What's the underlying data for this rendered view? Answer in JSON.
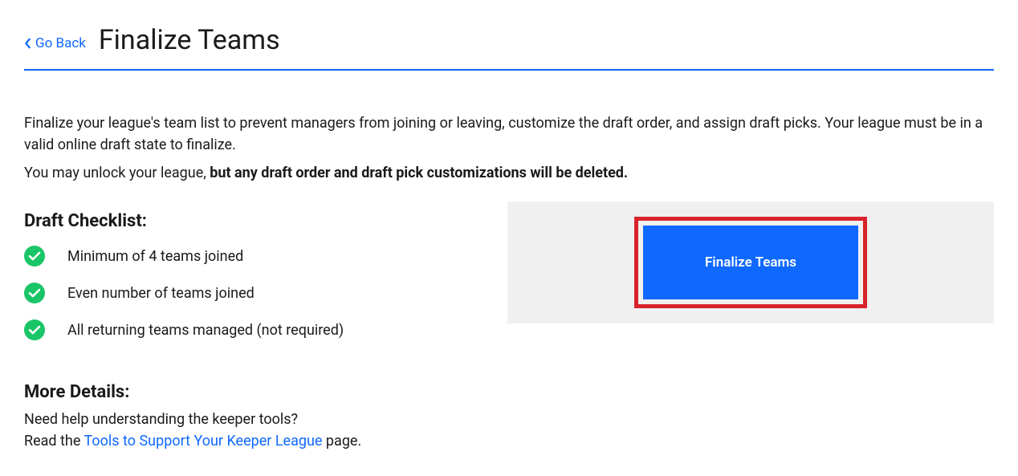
{
  "header": {
    "goBack": "Go Back",
    "title": "Finalize Teams"
  },
  "intro": "Finalize your league's team list to prevent managers from joining or leaving, customize the draft order, and assign draft picks. Your league must be in a valid online draft state to finalize.",
  "unlock": {
    "prefix": "You may unlock your league, ",
    "bold": "but any draft order and draft pick customizations will be deleted."
  },
  "checklistHeading": "Draft Checklist:",
  "checklist": [
    "Minimum of 4 teams joined",
    "Even number of teams joined",
    "All returning teams managed (not required)"
  ],
  "moreDetailsHeading": "More Details:",
  "help": {
    "line1": "Need help understanding the keeper tools?",
    "line2prefix": "Read the ",
    "linkText": "Tools to Support Your Keeper League",
    "line2suffix": " page."
  },
  "finalizeButton": "Finalize Teams",
  "colors": {
    "accent": "#0f69ff",
    "success": "#1ac567",
    "highlight": "#d8232a"
  }
}
